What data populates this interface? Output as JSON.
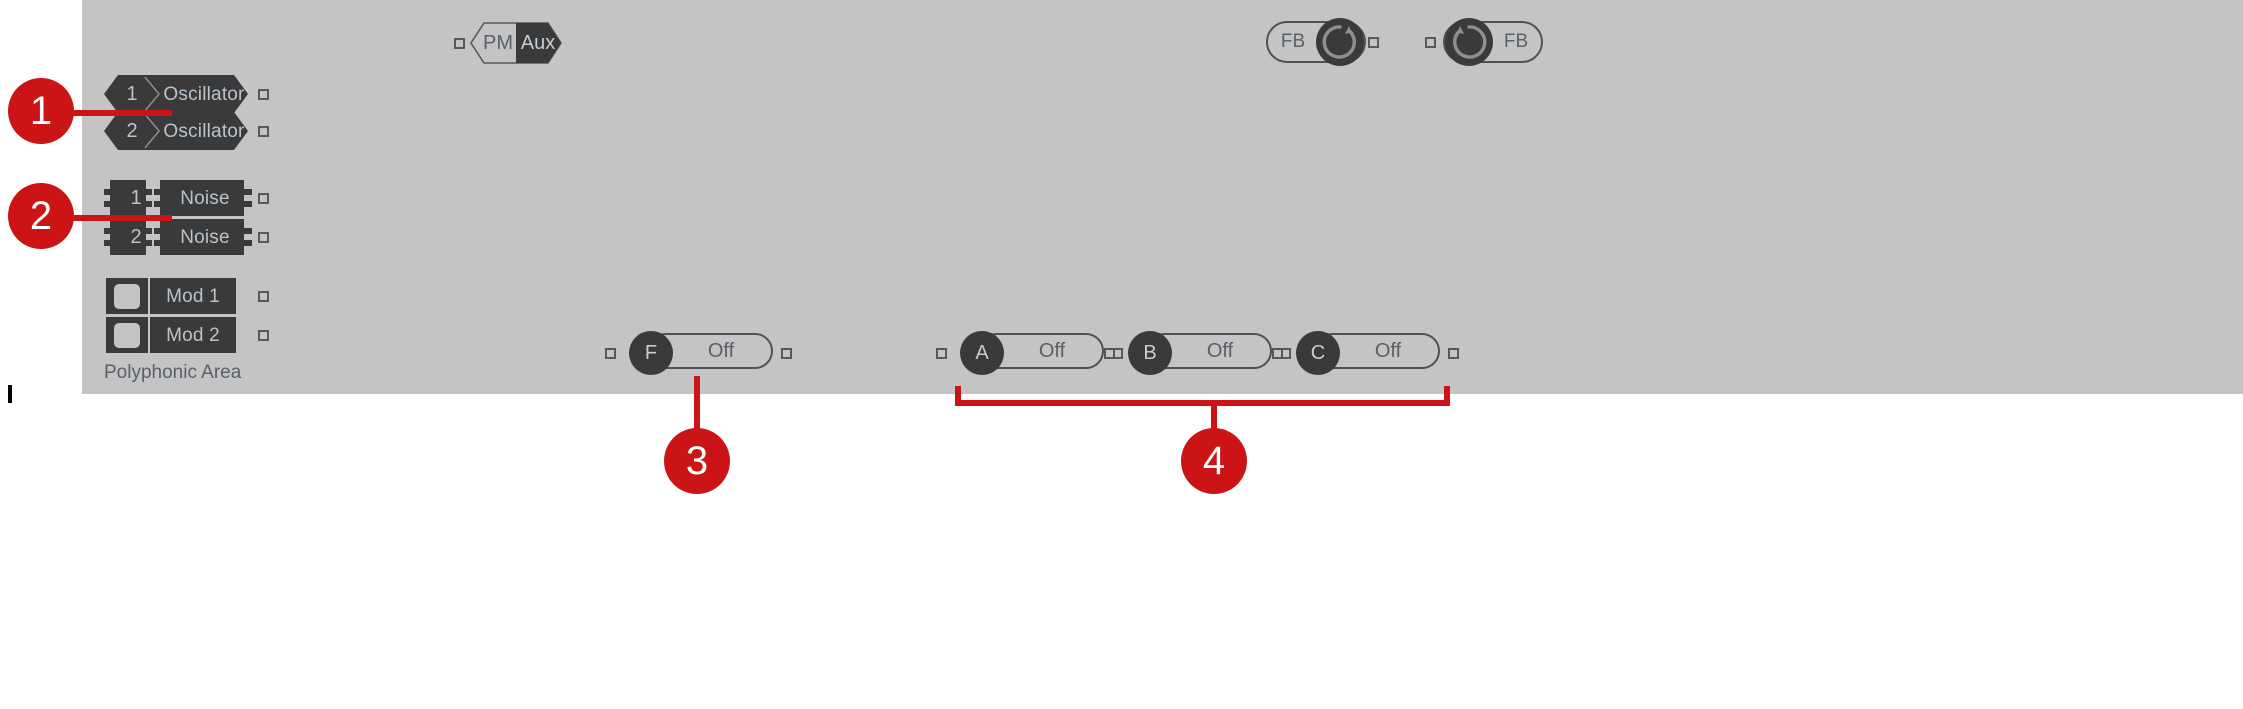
{
  "canvas": {
    "background": "#c4c4c4",
    "module_fill": "#3a3a3a",
    "module_text": "#b9c3cc",
    "outline": "#4d5256",
    "accent_red": "#cc1417",
    "caption_color": "#5a6068"
  },
  "area": {
    "caption": "Polyphonic Area"
  },
  "oscillators": [
    {
      "number": "1",
      "label": "Oscillator"
    },
    {
      "number": "2",
      "label": "Oscillator"
    }
  ],
  "noises": [
    {
      "number": "1",
      "label": "Noise"
    },
    {
      "number": "2",
      "label": "Noise"
    }
  ],
  "mods": [
    {
      "label": "Mod 1"
    },
    {
      "label": "Mod 2"
    }
  ],
  "pm_aux": {
    "left_label": "PM",
    "right_label": "Aux",
    "selected": "Aux"
  },
  "feedback": [
    {
      "label": "FB",
      "side": "left"
    },
    {
      "label": "FB",
      "side": "right"
    }
  ],
  "filter_control": {
    "letter": "F",
    "value": "Off"
  },
  "bus_controls": [
    {
      "letter": "A",
      "value": "Off"
    },
    {
      "letter": "B",
      "value": "Off"
    },
    {
      "letter": "C",
      "value": "Off"
    }
  ],
  "callouts": [
    {
      "number": "1"
    },
    {
      "number": "2"
    },
    {
      "number": "3"
    },
    {
      "number": "4"
    }
  ]
}
